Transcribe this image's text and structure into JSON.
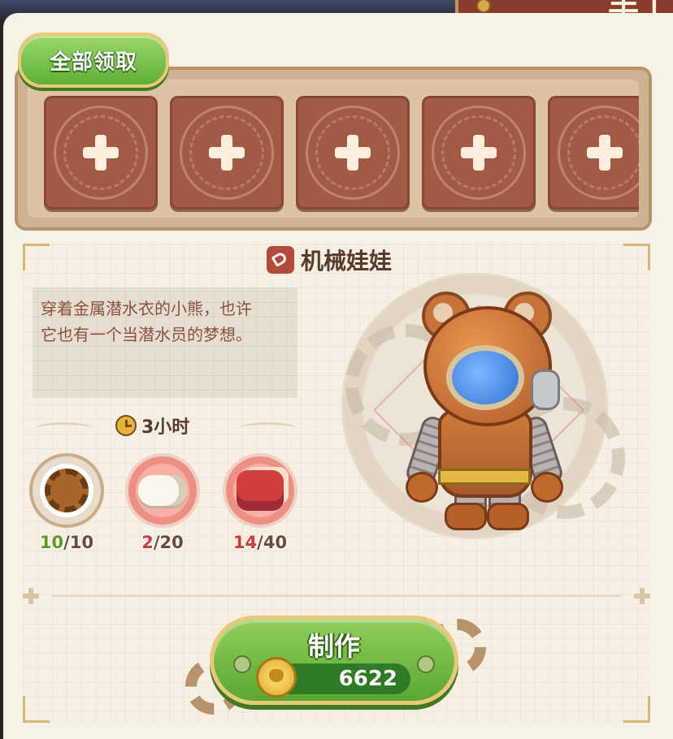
{
  "header": {
    "tab_title": "手工"
  },
  "claim_all_label": "全部领取",
  "slots": [
    {
      "state": "empty"
    },
    {
      "state": "empty"
    },
    {
      "state": "empty"
    },
    {
      "state": "empty"
    },
    {
      "state": "empty"
    }
  ],
  "item": {
    "name": "机械娃娃",
    "description_line1": "穿着金属潜水衣的小熊，也许",
    "description_line2": "它也有一个当潜水员的梦想。",
    "craft_time": "3小时"
  },
  "materials": [
    {
      "name": "gear",
      "have": "10",
      "need": "/10",
      "status": "ok"
    },
    {
      "name": "cotton-roll",
      "have": "2",
      "need": "/20",
      "status": "low"
    },
    {
      "name": "fabric",
      "have": "14",
      "need": "/40",
      "status": "low"
    }
  ],
  "craft": {
    "label": "制作",
    "cost": "6622"
  },
  "colors": {
    "accent_green": "#5fae36",
    "panel_bg": "#f7f2e8",
    "slot_red": "#a35a45",
    "warn_red": "#d23a3a"
  }
}
